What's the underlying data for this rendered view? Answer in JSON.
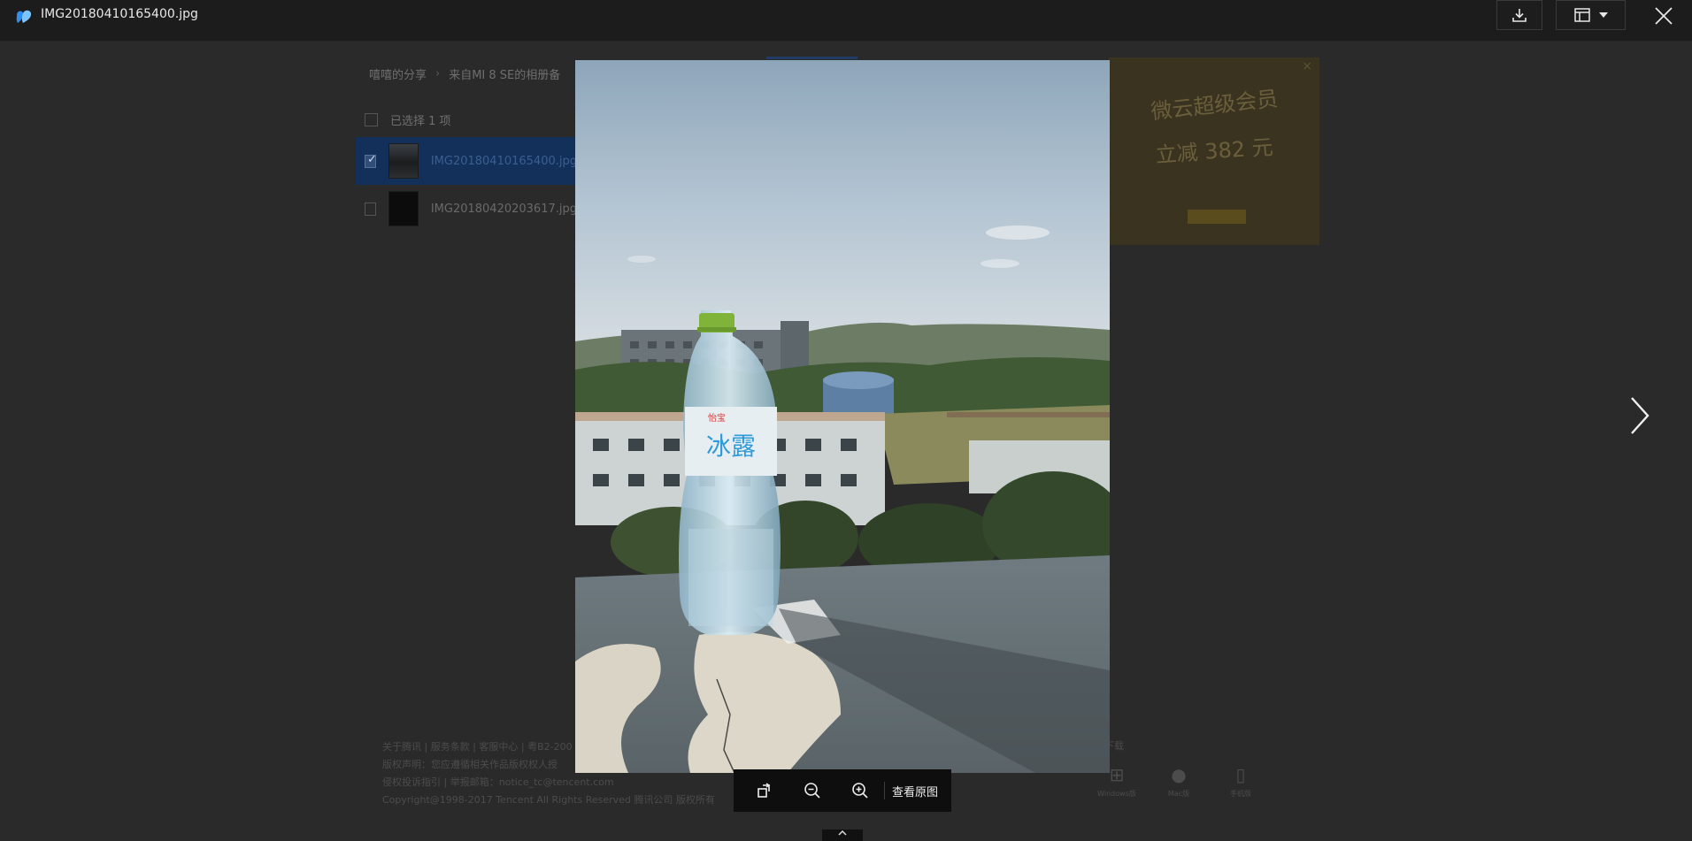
{
  "window": {
    "file_name": "IMG20180410165400.jpg",
    "icons": {
      "logo": "weiyun-logo",
      "download": "download-icon",
      "layout": "layout-icon",
      "dropdown": "chevron-down-icon",
      "close": "close-icon"
    }
  },
  "background_page": {
    "breadcrumb": [
      "嘻嘻的分享",
      "来自MI 8 SE的相册备"
    ],
    "selection_label": "已选择 1 项",
    "files": [
      {
        "name": "IMG20180410165400.jpg",
        "checked": true
      },
      {
        "name": "IMG20180420203617.jpg",
        "checked": false
      }
    ],
    "ad": {
      "title": "微云超级会员",
      "subtitle": "立减 382 元"
    },
    "footer_lines": [
      "关于腾讯 | 服务条款 | 客服中心 | 粤B2-200",
      "版权声明：您应遵循相关作品版权权人授",
      "侵权投诉指引 | 举报邮箱：notice_tc@tencent.com",
      "Copyright@1998-2017 Tencent All Rights Reserved 腾讯公司 版权所有"
    ],
    "download_label": "下载",
    "platforms": [
      {
        "label": "Windows版",
        "icon": "windows-icon"
      },
      {
        "label": "Mac版",
        "icon": "apple-icon"
      },
      {
        "label": "手机版",
        "icon": "phone-icon"
      }
    ]
  },
  "viewer": {
    "toolbar": {
      "rotate_icon": "rotate-icon",
      "zoom_out_icon": "zoom-out-icon",
      "zoom_in_icon": "zoom-in-icon",
      "view_original_label": "查看原图"
    },
    "next_icon": "chevron-right-icon",
    "collapse_icon": "chevron-up-icon",
    "photo_bottle_label": "冰露",
    "photo_bottle_brand": "怡宝"
  },
  "colors": {
    "topbar_bg": "#1c1c1c",
    "selected_row": "#13305b",
    "page_dim_bg": "#2a2a2a"
  }
}
